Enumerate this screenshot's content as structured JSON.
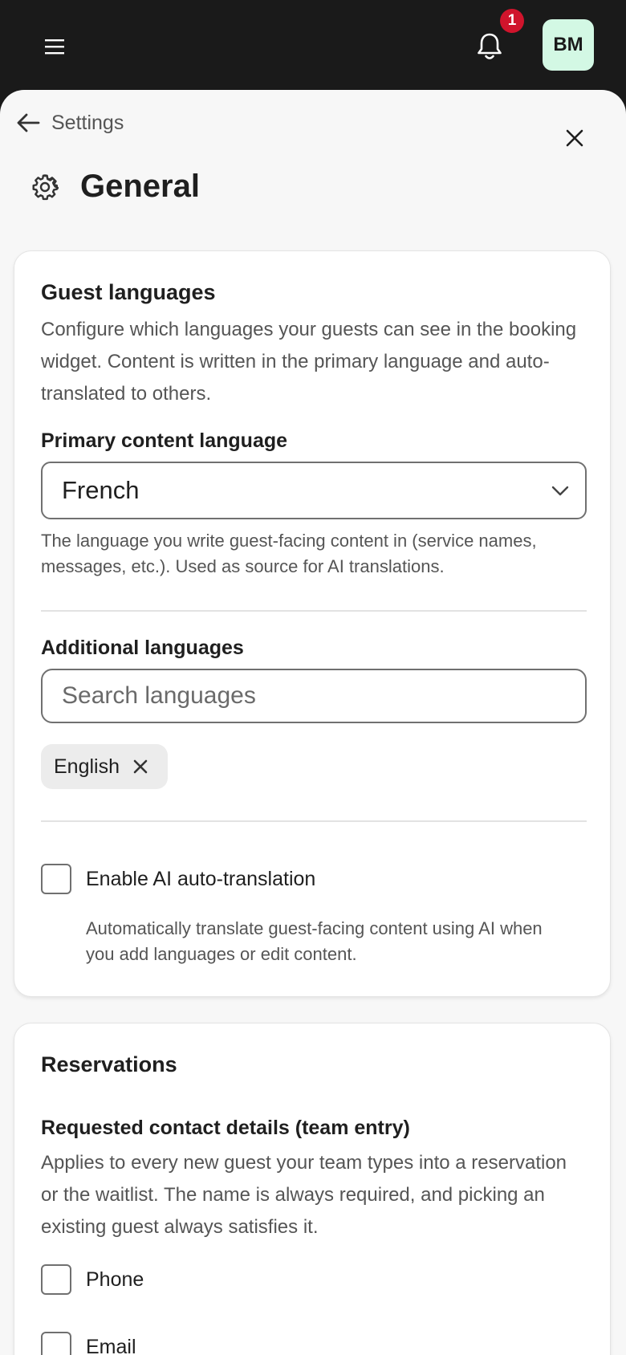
{
  "topbar": {
    "notification_count": "1",
    "avatar_initials": "BM",
    "icons": {
      "menu": "menu-icon",
      "bell": "bell-icon"
    }
  },
  "header": {
    "back_label": "Settings",
    "title": "General",
    "icons": {
      "back": "arrow-left-icon",
      "close": "close-icon",
      "gear": "gear-icon"
    }
  },
  "guest_languages": {
    "title": "Guest languages",
    "description": "Configure which languages your guests can see in the booking widget. Content is written in the primary language and auto-translated to others.",
    "primary_label": "Primary content language",
    "primary_value": "French",
    "primary_help": "The language you write guest-facing content in (service names, messages, etc.). Used as source for AI translations.",
    "additional_label": "Additional languages",
    "search_placeholder": "Search languages",
    "selected_languages": [
      "English"
    ],
    "auto_translate_label": "Enable AI auto-translation",
    "auto_translate_checked": false,
    "auto_translate_help": "Automatically translate guest-facing content using AI when you add languages or edit content."
  },
  "reservations": {
    "title": "Reservations",
    "contact_label": "Requested contact details (team entry)",
    "contact_description": "Applies to every new guest your team types into a reservation or the waitlist. The name is always required, and picking an existing guest always satisfies it.",
    "options": [
      {
        "label": "Phone",
        "checked": false
      },
      {
        "label": "Email",
        "checked": false
      }
    ]
  },
  "colors": {
    "topbar_bg": "#1a1a1a",
    "sheet_bg": "#f7f7f7",
    "badge_red": "#d0142c",
    "avatar_bg": "#d3f8e4"
  }
}
